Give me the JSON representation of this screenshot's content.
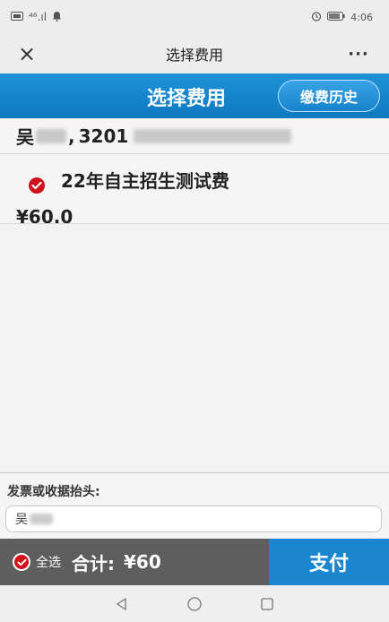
{
  "status_bar": {
    "left_text": "⁴⁶.ıl",
    "time": "4:06"
  },
  "title_bar": {
    "title": "选择费用",
    "close_glyph": "×",
    "more_glyph": "···"
  },
  "header": {
    "title": "选择费用",
    "history_button": "缴费历史"
  },
  "student": {
    "name_visible": "吴",
    "separator": ",",
    "id_visible": "3201"
  },
  "fees": [
    {
      "name": "22年自主招生测试费",
      "price": "¥60.0",
      "checked": true
    }
  ],
  "invoice": {
    "label": "发票或收据抬头:",
    "value_visible": "吴"
  },
  "footer": {
    "select_all_label": "全选",
    "total_label": "合计:",
    "total_value": "¥60",
    "pay_button": "支付"
  },
  "icons": {
    "check": "check-circle-icon",
    "nav_back": "triangle-back-icon",
    "nav_home": "circle-home-icon",
    "nav_recent": "square-recent-icon"
  },
  "colors": {
    "accent_blue": "#1a86d0",
    "check_red": "#d0101b",
    "footer_gray": "#5e5e5e"
  }
}
